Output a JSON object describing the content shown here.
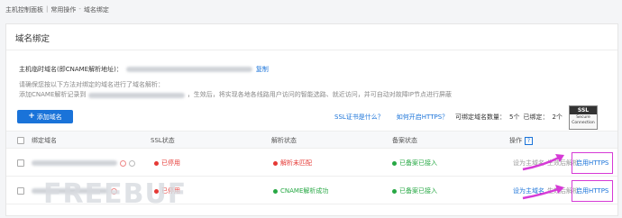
{
  "breadcrumb": [
    "主机控制面板",
    "常用操作",
    "域名绑定"
  ],
  "panel": {
    "title": "域名绑定",
    "host_label": "主机临时域名(即CNAME解析地址)：",
    "copy_link": "复制",
    "notice_line1": "请确保您按以下方法对绑定的域名进行了域名解析：",
    "notice_line2_prefix": "添加CNAME解析记录到",
    "notice_line2_suffix": "，生效后，将实现各地各线路用户访问的智能选路、就近访问，并可自动对故障IP节点进行屏蔽"
  },
  "toolbar": {
    "add_button": "添加域名",
    "add_plus": "+",
    "ssl_help": "SSL证书是什么？",
    "https_help": "如何开启HTTPS？",
    "bindable_label": "可绑定域名数量：",
    "bindable_value": "5个",
    "bound_label": "已绑定：",
    "bound_value": "2个"
  },
  "ssl_badge": {
    "top": "SSL",
    "bottom": "Secure Connection"
  },
  "table": {
    "columns": [
      "绑定域名",
      "SSL状态",
      "解析状态",
      "备案状态",
      "操作"
    ],
    "help_icon": "?",
    "rows": [
      {
        "ssl_status": "已停用",
        "dns_status": "解析未匹配",
        "icp_status": "已备案已接入",
        "action_primary": "设为主域名",
        "action_note": "生效后解析",
        "action_enable": "启用HTTPS"
      },
      {
        "ssl_status": "已停用",
        "dns_status": "CNAME解析成功",
        "icp_status": "已备案已接入",
        "action_primary": "设为主域名",
        "action_note": "生效后解析",
        "action_enable": "启用HTTPS"
      }
    ]
  },
  "watermark": "FREEBUF",
  "colors": {
    "accent": "#1a73d9",
    "error": "#e53935",
    "success": "#27a844",
    "highlight": "#d63ad6"
  }
}
